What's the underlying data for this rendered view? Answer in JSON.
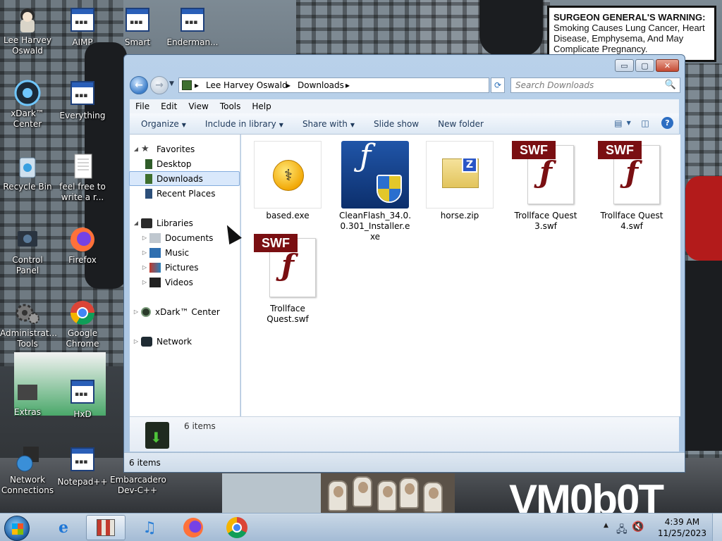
{
  "desktop": {
    "icons": [
      {
        "label": "Lee Harvey Oswald",
        "icon": "person-icon"
      },
      {
        "label": "AIMP",
        "icon": "app-window-icon"
      },
      {
        "label": "Smart",
        "icon": "app-window-icon"
      },
      {
        "label": "Enderman...",
        "icon": "app-window-icon"
      },
      {
        "label": "xDark™ Center",
        "icon": "xdark-center-icon"
      },
      {
        "label": "Everything",
        "icon": "app-window-icon"
      },
      {
        "label": "Recycle Bin",
        "icon": "recycle-bin-icon"
      },
      {
        "label": "feel free to write a r...",
        "icon": "text-document-icon"
      },
      {
        "label": "Control Panel",
        "icon": "control-panel-icon"
      },
      {
        "label": "Firefox",
        "icon": "firefox-icon"
      },
      {
        "label": "Administrat... Tools",
        "icon": "gears-icon"
      },
      {
        "label": "Google Chrome",
        "icon": "chrome-icon"
      },
      {
        "label": "Extras",
        "icon": "folder-icon"
      },
      {
        "label": "HxD",
        "icon": "app-window-icon"
      },
      {
        "label": "Network Connections",
        "icon": "network-globe-icon"
      },
      {
        "label": "Notepad++",
        "icon": "app-window-icon"
      },
      {
        "label": "Embarcadero Dev-C++",
        "icon": "devcpp-icon"
      }
    ]
  },
  "wallpaper": {
    "warning_title": "SURGEON GENERAL'S WARNING:",
    "warning_text": "Smoking Causes Lung Cancer, Heart Disease, Emphysema, And May Complicate Pregnancy.",
    "graffiti": "VM0b0T"
  },
  "window": {
    "caption_buttons": {
      "minimize": "▭",
      "maximize": "▢",
      "close": "✕"
    },
    "address": {
      "crumbs": [
        "Lee Harvey Oswald",
        "Downloads"
      ],
      "separator": "▸",
      "dropdown": "▾",
      "refresh": "⟳"
    },
    "search": {
      "placeholder": "Search Downloads",
      "icon": "🔍"
    },
    "menu": [
      "File",
      "Edit",
      "View",
      "Tools",
      "Help"
    ],
    "toolbar": {
      "organize": "Organize",
      "include_in_library": "Include in library",
      "share_with": "Share with",
      "slide_show": "Slide show",
      "new_folder": "New folder",
      "help": "?"
    },
    "nav": {
      "favorites": "Favorites",
      "desktop": "Desktop",
      "downloads": "Downloads",
      "recent_places": "Recent Places",
      "libraries": "Libraries",
      "documents": "Documents",
      "music": "Music",
      "pictures": "Pictures",
      "videos": "Videos",
      "xdark_center": "xDark™ Center",
      "network": "Network"
    },
    "files": [
      {
        "name": "based.exe",
        "type": "exe"
      },
      {
        "name": "CleanFlash_34.0.0.301_Installer.exe",
        "type": "installer"
      },
      {
        "name": "horse.zip",
        "type": "zip"
      },
      {
        "name": "Trollface Quest 3.swf",
        "type": "swf"
      },
      {
        "name": "Trollface Quest 4.swf",
        "type": "swf"
      },
      {
        "name": "Trollface Quest.swf",
        "type": "swf"
      }
    ],
    "swf_tag": "SWF",
    "details_count": "6 items",
    "status_count": "6 items"
  },
  "taskbar": {
    "time": "4:39 AM",
    "date": "11/25/2023"
  }
}
